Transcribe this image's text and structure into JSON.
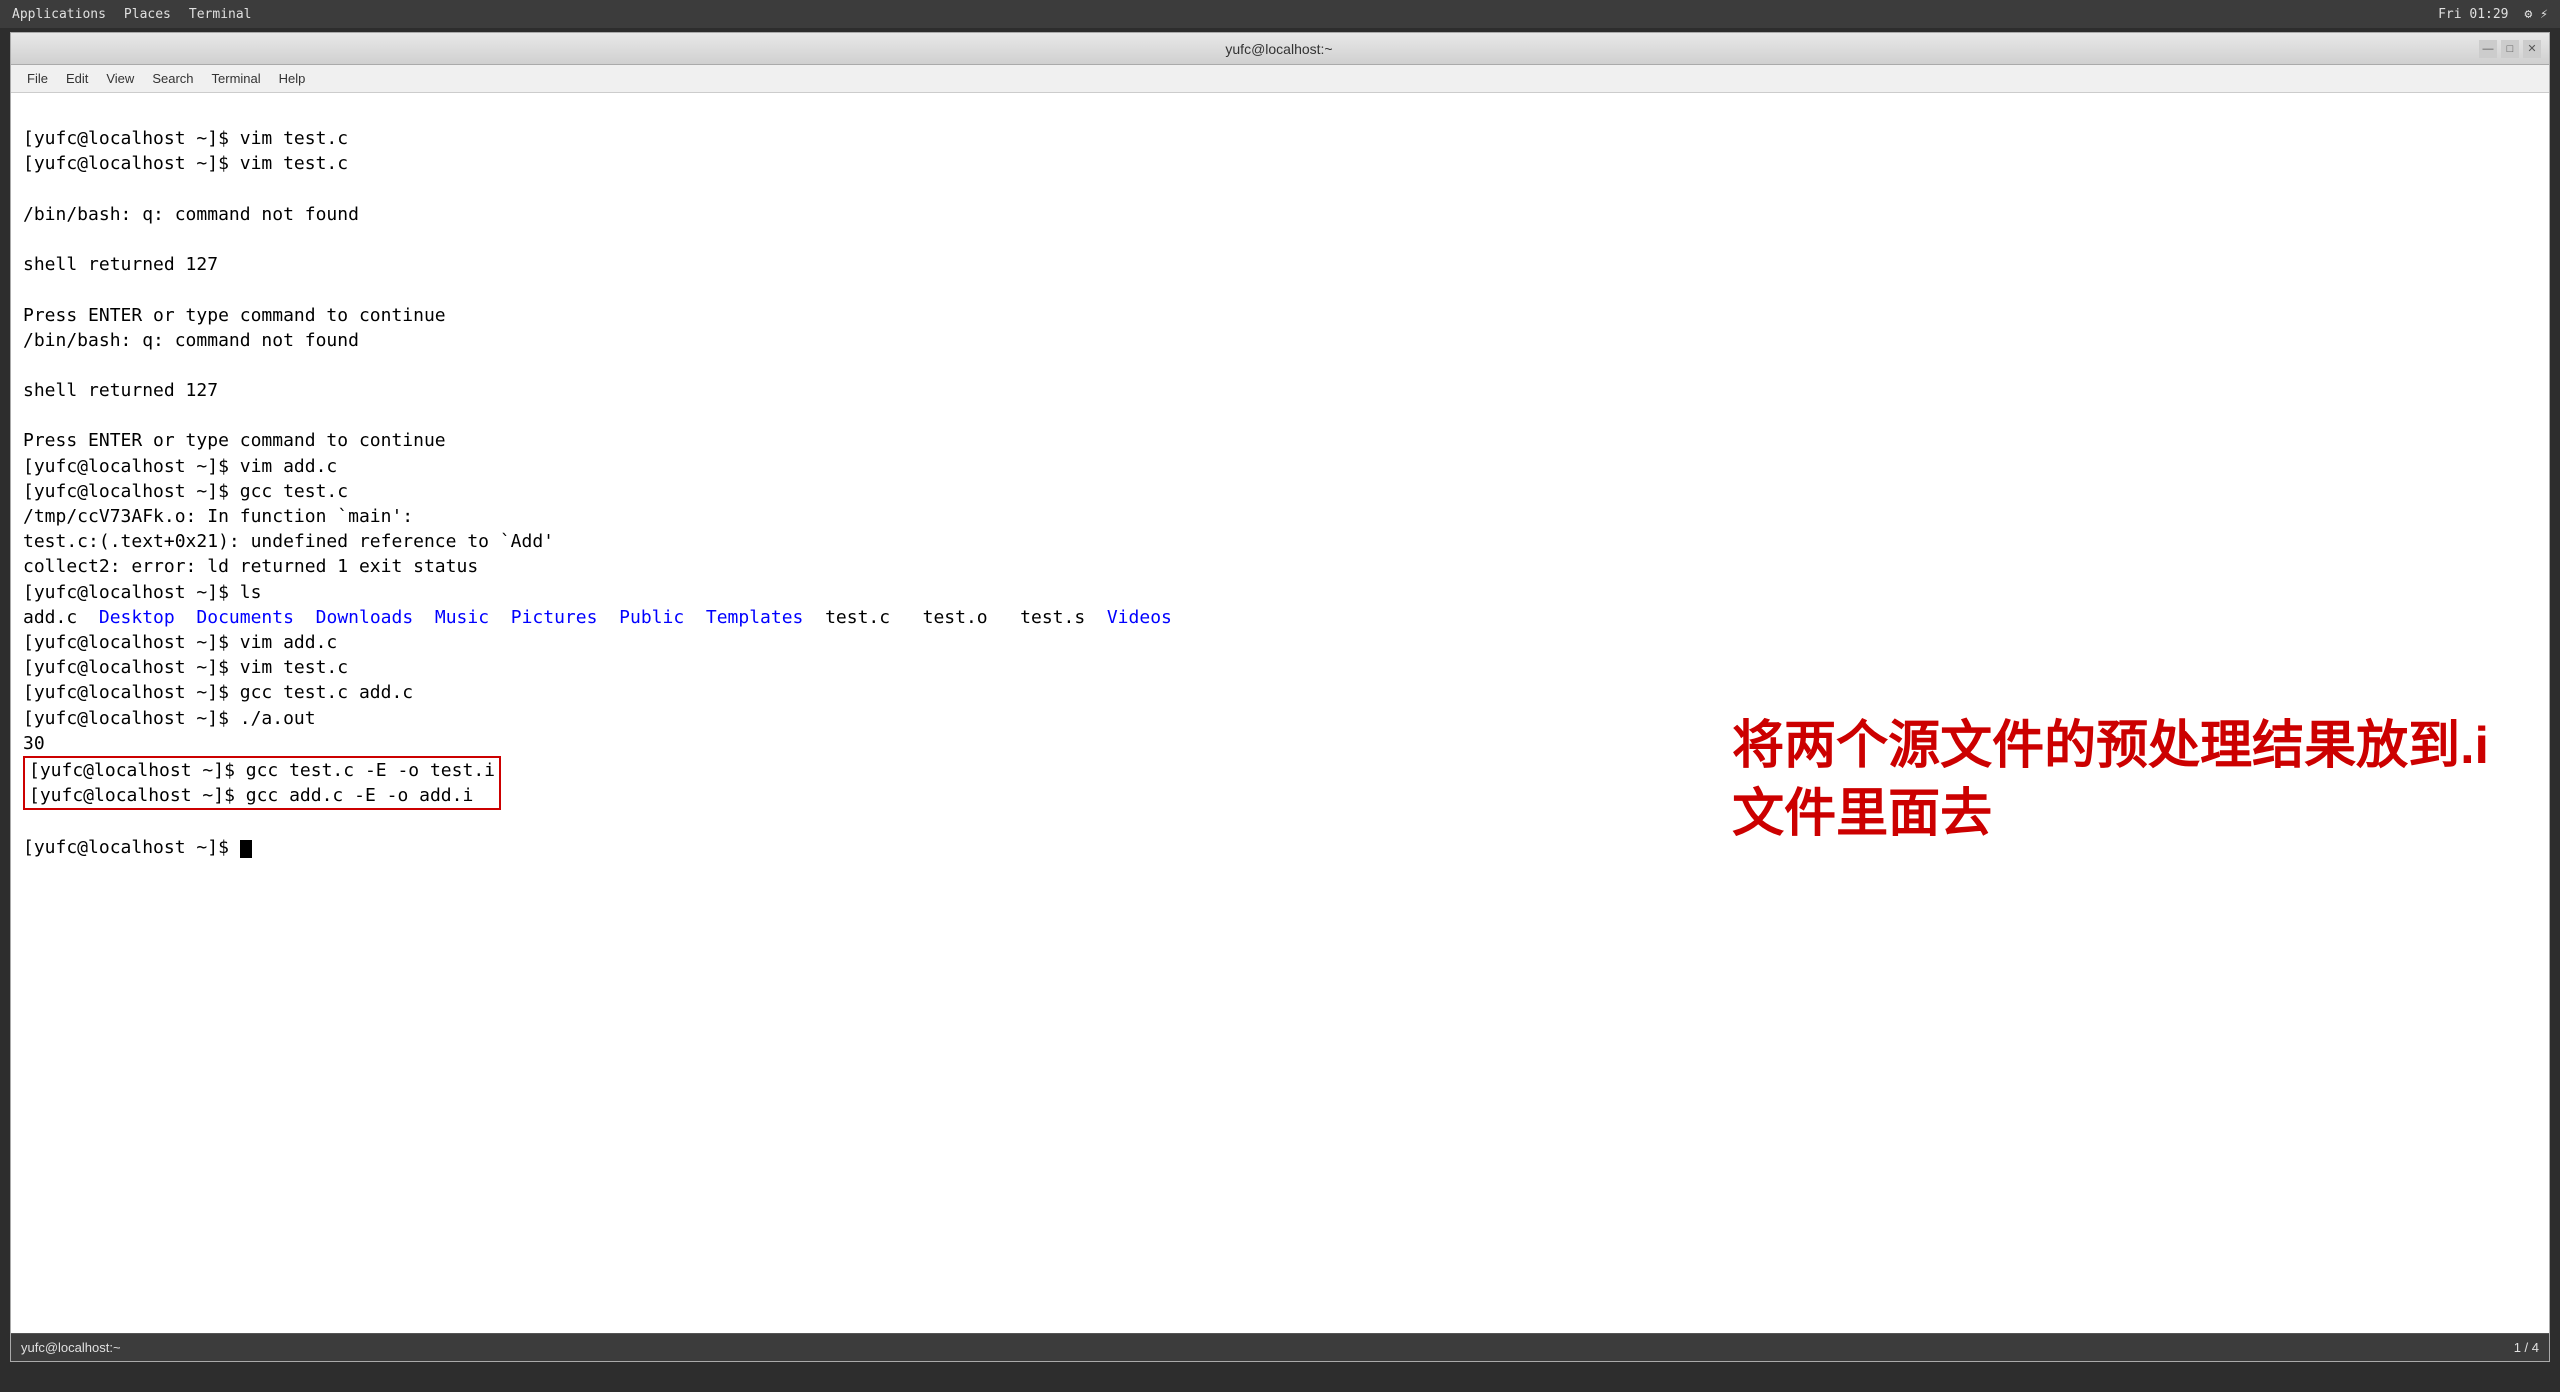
{
  "systemBar": {
    "apps": "Applications",
    "places": "Places",
    "terminal": "Terminal",
    "time": "Fri 01:29",
    "icons": "⚙ ⚡"
  },
  "titleBar": {
    "title": "yufc@localhost:~",
    "minimize": "—",
    "maximize": "□",
    "close": "✕"
  },
  "menuBar": {
    "items": [
      "File",
      "Edit",
      "View",
      "Search",
      "Terminal",
      "Help"
    ]
  },
  "terminal": {
    "lines": [
      {
        "type": "prompt",
        "text": "[yufc@localhost ~]$ vim test.c"
      },
      {
        "type": "prompt",
        "text": "[yufc@localhost ~]$ vim test.c"
      },
      {
        "type": "blank",
        "text": ""
      },
      {
        "type": "output",
        "text": "/bin/bash: q: command not found"
      },
      {
        "type": "blank",
        "text": ""
      },
      {
        "type": "output",
        "text": "shell returned 127"
      },
      {
        "type": "blank",
        "text": ""
      },
      {
        "type": "output",
        "text": "Press ENTER or type command to continue"
      },
      {
        "type": "output",
        "text": "/bin/bash: q: command not found"
      },
      {
        "type": "blank",
        "text": ""
      },
      {
        "type": "output",
        "text": "shell returned 127"
      },
      {
        "type": "blank",
        "text": ""
      },
      {
        "type": "output",
        "text": "Press ENTER or type command to continue"
      },
      {
        "type": "prompt",
        "text": "[yufc@localhost ~]$ vim add.c"
      },
      {
        "type": "prompt",
        "text": "[yufc@localhost ~]$ gcc test.c"
      },
      {
        "type": "output",
        "text": "/tmp/ccV73AFk.o: In function `main':"
      },
      {
        "type": "output",
        "text": "test.c:(.text+0x21): undefined reference to `Add'"
      },
      {
        "type": "output",
        "text": "collect2: error: ld returned 1 exit status"
      },
      {
        "type": "prompt",
        "text": "[yufc@localhost ~]$ ls"
      },
      {
        "type": "ls",
        "text": ""
      },
      {
        "type": "prompt",
        "text": "[yufc@localhost ~]$ vim add.c"
      },
      {
        "type": "prompt",
        "text": "[yufc@localhost ~]$ vim test.c"
      },
      {
        "type": "prompt",
        "text": "[yufc@localhost ~]$ gcc test.c add.c"
      },
      {
        "type": "prompt",
        "text": "[yufc@localhost ~]$ ./a.out"
      },
      {
        "type": "output",
        "text": "30"
      },
      {
        "type": "boxed_prompt",
        "text": "[yufc@localhost ~]$ gcc test.c -E -o test.i"
      },
      {
        "type": "boxed_prompt",
        "text": "[yufc@localhost ~]$ gcc add.c -E -o add.i"
      },
      {
        "type": "current",
        "text": "[yufc@localhost ~]$ "
      }
    ],
    "lsOutput": {
      "plain": "add.c  ",
      "blue": [
        "Desktop",
        "Documents",
        "Downloads",
        "Music",
        "Pictures",
        "Public",
        "Templates"
      ],
      "plain2": "  test.c   test.o   test.s  ",
      "blue2": [
        "Videos"
      ]
    },
    "annotation": {
      "line1": "将两个源文件的预处理结果放到.i",
      "line2": "文件里面去"
    }
  },
  "statusBar": {
    "label": "yufc@localhost:~",
    "pageInfo": "1 / 4"
  }
}
